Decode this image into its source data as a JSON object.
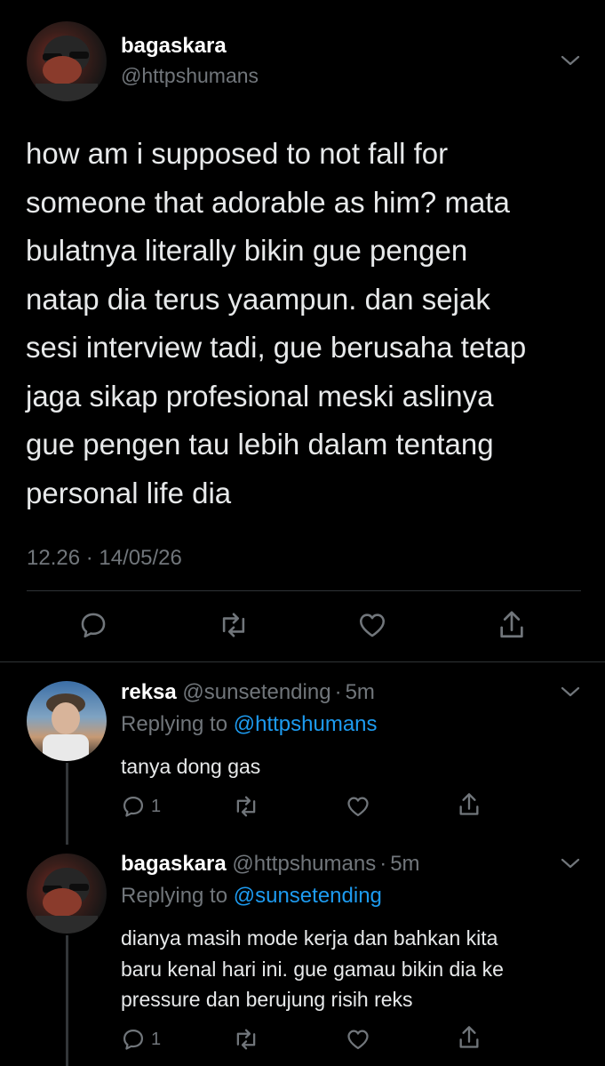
{
  "main_tweet": {
    "display_name": "bagaskara",
    "handle": "@httpshumans",
    "text_lines": [
      "how am i supposed to not fall for",
      "someone that adorable as him? mata",
      "bulatnya literally bikin gue pengen",
      "natap dia terus yaampun. dan sejak",
      "sesi interview tadi, gue berusaha tetap",
      "jaga sikap profesional meski aslinya",
      "gue pengen tau lebih dalam tentang",
      "personal life dia"
    ],
    "timestamp": "12.26 · 14/05/26"
  },
  "replies": [
    {
      "display_name": "reksa",
      "handle": "@sunsetending",
      "sep": "·",
      "age": "5m",
      "replying_prefix": "Replying to",
      "replying_to": "@httpshumans",
      "text_lines": [
        "tanya dong gas"
      ],
      "reply_count": "1"
    },
    {
      "display_name": "bagaskara",
      "handle": "@httpshumans",
      "sep": "·",
      "age": "5m",
      "replying_prefix": "Replying to",
      "replying_to": "@sunsetending",
      "text_lines": [
        "dianya masih mode kerja dan bahkan kita",
        "baru kenal hari ini. gue gamau bikin dia ke",
        "pressure dan berujung risih reks"
      ],
      "reply_count": "1"
    }
  ],
  "icons": {
    "more": "chevron-down-icon",
    "reply": "reply-icon",
    "retweet": "retweet-icon",
    "like": "heart-icon",
    "share": "share-icon"
  },
  "colors": {
    "background": "#000000",
    "text": "#e7e9ea",
    "muted": "#71767b",
    "link": "#1d9bf0",
    "divider": "#2f3336"
  }
}
